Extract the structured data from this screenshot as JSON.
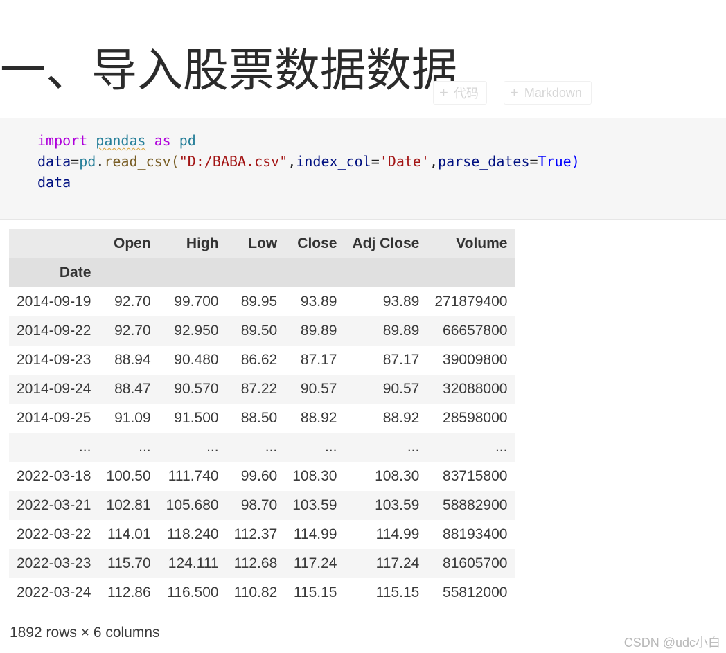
{
  "heading": "一、导入股票数据数据",
  "cell_toolbar": {
    "add_code_label": "代码",
    "add_markdown_label": "Markdown"
  },
  "code": {
    "line1": {
      "kw_import": "import",
      "module": "pandas",
      "kw_as": "as",
      "alias": "pd"
    },
    "line2": {
      "var": "data",
      "eq": "=",
      "obj": "pd",
      "dot": ".",
      "fn": "read_csv",
      "open": "(",
      "path": "\"D:/BABA.csv\"",
      "c1": ",",
      "arg1": "index_col",
      "eq1": "=",
      "val1": "'Date'",
      "c2": ",",
      "arg2": "parse_dates",
      "eq2": "=",
      "val2": "True",
      "close": ")"
    },
    "line3": "data"
  },
  "table": {
    "columns": [
      "Open",
      "High",
      "Low",
      "Close",
      "Adj Close",
      "Volume"
    ],
    "index_name": "Date",
    "rows": [
      {
        "date": "2014-09-19",
        "cells": [
          "92.70",
          "99.700",
          "89.95",
          "93.89",
          "93.89",
          "271879400"
        ]
      },
      {
        "date": "2014-09-22",
        "cells": [
          "92.70",
          "92.950",
          "89.50",
          "89.89",
          "89.89",
          "66657800"
        ]
      },
      {
        "date": "2014-09-23",
        "cells": [
          "88.94",
          "90.480",
          "86.62",
          "87.17",
          "87.17",
          "39009800"
        ]
      },
      {
        "date": "2014-09-24",
        "cells": [
          "88.47",
          "90.570",
          "87.22",
          "90.57",
          "90.57",
          "32088000"
        ]
      },
      {
        "date": "2014-09-25",
        "cells": [
          "91.09",
          "91.500",
          "88.50",
          "88.92",
          "88.92",
          "28598000"
        ]
      },
      {
        "date": "...",
        "cells": [
          "...",
          "...",
          "...",
          "...",
          "...",
          "..."
        ]
      },
      {
        "date": "2022-03-18",
        "cells": [
          "100.50",
          "111.740",
          "99.60",
          "108.30",
          "108.30",
          "83715800"
        ]
      },
      {
        "date": "2022-03-21",
        "cells": [
          "102.81",
          "105.680",
          "98.70",
          "103.59",
          "103.59",
          "58882900"
        ]
      },
      {
        "date": "2022-03-22",
        "cells": [
          "114.01",
          "118.240",
          "112.37",
          "114.99",
          "114.99",
          "88193400"
        ]
      },
      {
        "date": "2022-03-23",
        "cells": [
          "115.70",
          "124.111",
          "112.68",
          "117.24",
          "117.24",
          "81605700"
        ]
      },
      {
        "date": "2022-03-24",
        "cells": [
          "112.86",
          "116.500",
          "110.82",
          "115.15",
          "115.15",
          "55812000"
        ]
      }
    ]
  },
  "footer": "1892 rows × 6 columns",
  "watermark": "CSDN @udc小白"
}
